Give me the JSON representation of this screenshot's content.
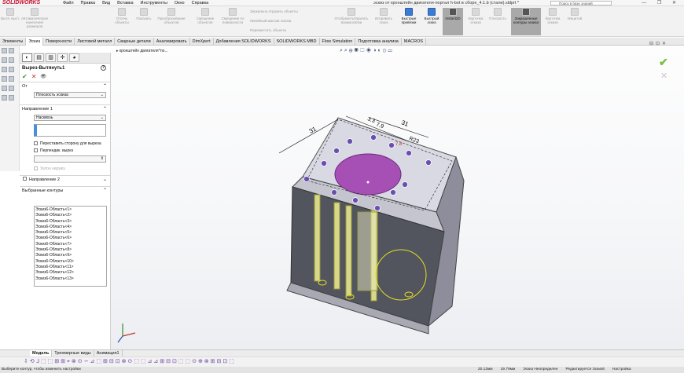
{
  "app": {
    "logo": "SOLIDWORKS",
    "menu": [
      "Файл",
      "Правка",
      "Вид",
      "Вставка",
      "Инструменты",
      "Окно",
      "Справка"
    ],
    "document_title": "эскиз от кронштейн двигателя-портал h-bot в сборе_4.1.b (стали).sldprt *",
    "search_placeholder": "Поиск в базе знаний",
    "window_controls": "— ❐ ✕"
  },
  "ribbon": {
    "items": [
      "Вытя. выст.",
      "Автоматическое нанесение размеров",
      "Отсечь объекты",
      "Показать",
      "Преобразование объектов",
      "Смещение объектов",
      "Смещение по поверхности",
      "Зеркально отразить объекты",
      "Линейный массив эскиза",
      "Переместить объекты",
      "Отобразить/Удалить взаимосвязи",
      "Исправить эскиз",
      "Быстрые привязки",
      "Быстрый эскиз",
      "Instant2D",
      "Карточка эскиза",
      "Плоскость",
      "Закрашенные контуры эскиза",
      "Карточка эскиза",
      "Мацетой"
    ]
  },
  "tabs": [
    "Элементы",
    "Эскиз",
    "Поверхности",
    "Листовой металл",
    "Сварные детали",
    "Анализировать",
    "DimXpert",
    "Добавления SOLIDWORKS",
    "SOLIDWORKS MBD",
    "Flow Simulation",
    "Подготовка анализа",
    "MACROS"
  ],
  "tabs_active": "Эскиз",
  "pm": {
    "title": "Вырез-Вытянуть1",
    "ok": "✔",
    "cancel": "✕",
    "preview": "👁",
    "from_label": "От",
    "from_value": "Плоскость эскиза",
    "dir1_label": "Направление 1",
    "dir1_value": "Насквозь",
    "flip_label": "Переставить сторону для выреза",
    "normal_label": "Перпендик. вырез",
    "draft_label": "Уклон наружу",
    "dir2_label": "Направление 2",
    "contours_label": "Выбранные контуры",
    "contours": [
      "Эскиз6-Область<1>",
      "Эскиз6-Область<2>",
      "Эскиз6-Область<3>",
      "Эскиз6-Область<4>",
      "Эскиз6-Область<5>",
      "Эскиз6-Область<6>",
      "Эскиз6-Область<7>",
      "Эскиз6-Область<8>",
      "Эскиз6-Область<9>",
      "Эскиз6-Область<10>",
      "Эскиз6-Область<11>",
      "Эскиз6-Область<12>",
      "Эскиз6-Область<13>"
    ]
  },
  "viewport": {
    "breadcrumb": "▸ кронштейн двигателя^по...",
    "dims": [
      "31",
      "31",
      "3.3",
      "7.9",
      "R23",
      "7.8"
    ]
  },
  "bottom_tabs": [
    "Модель",
    "Трехмерные виды",
    "Анимация1"
  ],
  "bottom_tabs_active": "Модель",
  "status": {
    "left": "Выберите контур, чтобы изменить настройки",
    "x": "20.12мм",
    "y": "19.79мм",
    "state": "Эскиз Неопределен",
    "mode": "Редактируется Эскиз6",
    "settings": "Настройка"
  }
}
